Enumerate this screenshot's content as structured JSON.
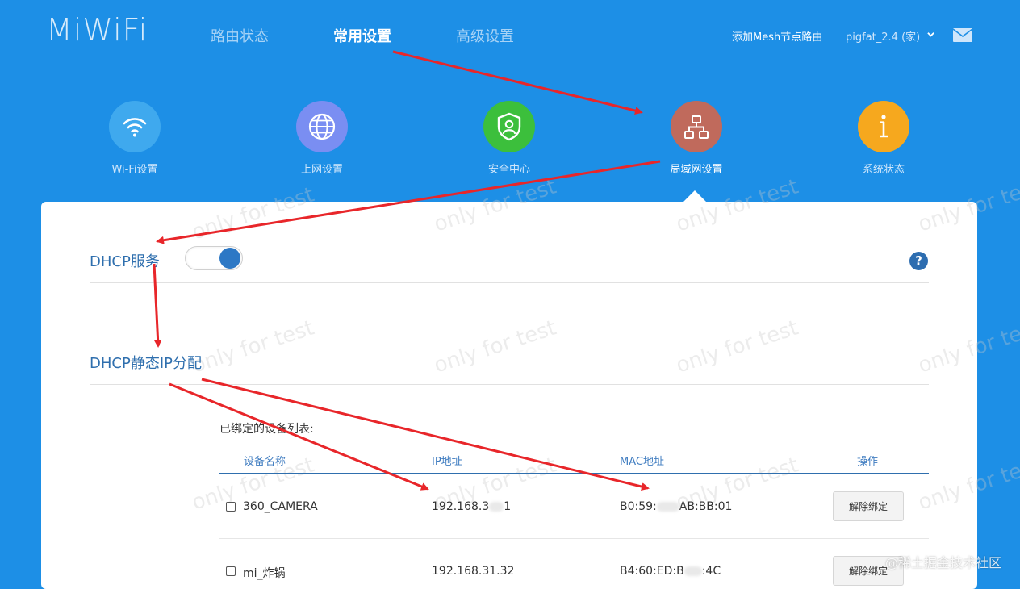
{
  "header": {
    "logo": "MiWiFi",
    "nav": [
      {
        "label": "路由状态",
        "active": false
      },
      {
        "label": "常用设置",
        "active": true
      },
      {
        "label": "高级设置",
        "active": false
      }
    ],
    "add_mesh": "添加Mesh节点路由",
    "network_select": "pigfat_2.4 (家)"
  },
  "categories": [
    {
      "label": "Wi-Fi设置",
      "icon": "wifi-icon",
      "color": "#3fa9ee"
    },
    {
      "label": "上网设置",
      "icon": "globe-icon",
      "color": "#7a8ef2"
    },
    {
      "label": "安全中心",
      "icon": "shield-user-icon",
      "color": "#3cbf3c"
    },
    {
      "label": "局域网设置",
      "icon": "network-topology-icon",
      "color": "#c06a5c"
    },
    {
      "label": "系统状态",
      "icon": "info-icon",
      "color": "#f6a81e"
    }
  ],
  "dhcp": {
    "title": "DHCP服务",
    "enabled": true,
    "help": "?"
  },
  "static_ip": {
    "title": "DHCP静态IP分配",
    "list_title": "已绑定的设备列表:",
    "columns": [
      "设备名称",
      "IP地址",
      "MAC地址",
      "操作"
    ],
    "rows": [
      {
        "name": "360_CAMERA",
        "ip": "192.168.3",
        "ip_tail": "1",
        "mac": "B0:59:",
        "mac_tail": "AB:BB:01",
        "action": "解除绑定"
      },
      {
        "name": "mi_炸锅",
        "ip": "192.168.31.32",
        "mac": "B4:60:ED:B",
        "mac_tail": ":4C",
        "action": "解除绑定"
      }
    ]
  },
  "watermark": "only for test",
  "source_mark": "@稀土掘金技术社区",
  "colors": {
    "background": "#1d8fe6",
    "accent": "#2f6fae",
    "arrow": "#e8262a"
  }
}
